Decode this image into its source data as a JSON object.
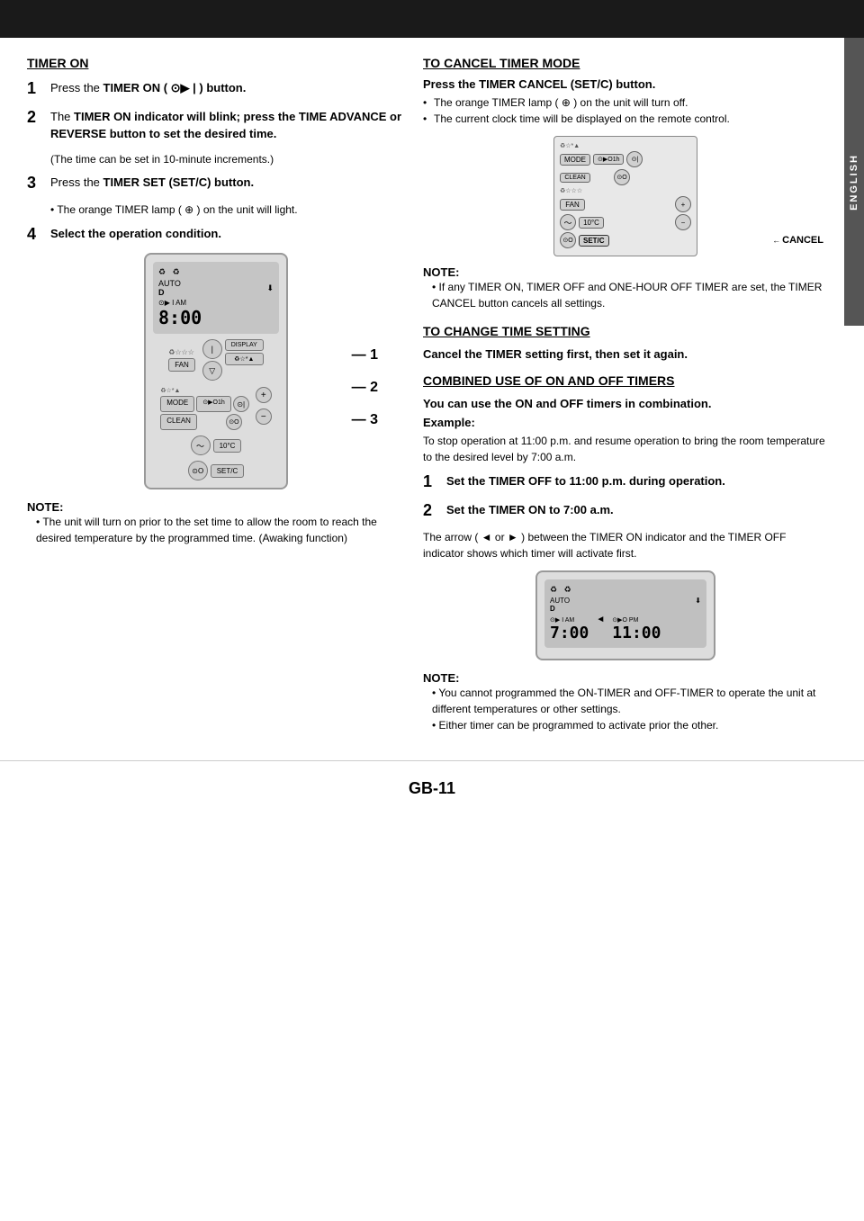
{
  "topBar": {},
  "sidebar": {
    "label": "ENGLISH"
  },
  "leftCol": {
    "timerOn": {
      "title": "TIMER ON",
      "steps": [
        {
          "num": "1",
          "text": "Press the TIMER ON ( ⊙▶ | ) button."
        },
        {
          "num": "2",
          "text": "The TIMER ON indicator will blink; press the TIME ADVANCE or REVERSE button to set the desired time.",
          "sub": "(The time can be set in 10-minute increments.)"
        },
        {
          "num": "3",
          "text": "Press the TIMER SET (SET/C) button.",
          "sub": "• The orange TIMER lamp ( ⊕ ) on the unit will light."
        },
        {
          "num": "4",
          "text": "Select the operation condition."
        }
      ]
    },
    "remote": {
      "icons_top": "♻ ♻",
      "auto_label": "AUTO",
      "auto_d": "D",
      "time_label": "⊙▶ I AM",
      "time_value": "8:00",
      "display_label": "DISPLAY",
      "mode_btn": "MODE",
      "mode_icons": "♻☆*▲",
      "timer1h": "⊙▶O1h",
      "timer_on": "⊙▶ |",
      "clean_btn": "CLEAN",
      "timer_oo": "⊙▶O",
      "fan_btn": "FAN",
      "fan_icons": "♻☆☆☆",
      "plus_btn": "+",
      "wave_btn": "~",
      "temp_btn": "10°C",
      "minus_btn": "−",
      "circle_btn": "⊙O",
      "setc_btn": "SET/C",
      "step_labels": [
        "1",
        "2",
        "3"
      ]
    },
    "note": {
      "title": "NOTE:",
      "text": "The unit will turn on prior to the set time to allow the room to reach the desired temperature by the programmed time. (Awaking function)"
    }
  },
  "rightCol": {
    "cancelSection": {
      "title": "TO CANCEL TIMER MODE",
      "pressLabel": "Press the TIMER CANCEL (SET/C) button.",
      "bullets": [
        "The orange TIMER lamp ( ⊕ ) on the unit will turn off.",
        "The current clock time will be displayed on the remote control."
      ],
      "remote": {
        "mode_icons": "♻☆*▲",
        "mode_btn": "MODE",
        "timer1h": "⊙▶O1h",
        "timer_on": "⊙▶ |",
        "clean_btn": "CLEAN",
        "timer_oo": "⊙▶O",
        "fan_icons": "♻☆☆☆",
        "fan_btn": "FAN",
        "plus_btn": "+",
        "wave_btn": "~",
        "temp_btn": "10°C",
        "minus_btn": "−",
        "circle_btn": "⊙O",
        "setc_btn": "SET/C",
        "cancel_label": "CANCEL"
      },
      "note": {
        "title": "NOTE:",
        "text": "If any TIMER ON, TIMER OFF and ONE-HOUR OFF TIMER are set, the TIMER CANCEL button cancels all settings."
      }
    },
    "changeSection": {
      "title": "TO CHANGE TIME SETTING",
      "text": "Cancel the TIMER setting first, then set it again."
    },
    "combinedSection": {
      "title": "COMBINED USE OF ON AND OFF TIMERS",
      "intro": "You can use the ON and OFF timers in combination.",
      "exampleLabel": "Example:",
      "exampleText": "To stop operation at 11:00 p.m. and resume operation to bring the room temperature to the desired level by 7:00 a.m.",
      "steps": [
        {
          "num": "1",
          "text": "Set the TIMER OFF to 11:00 p.m. during operation."
        },
        {
          "num": "2",
          "text": "Set the TIMER ON to 7:00 a.m."
        }
      ],
      "arrowText": "The arrow ( ◄ or ► ) between the TIMER ON indicator and the TIMER OFF indicator shows which timer will activate first.",
      "remote": {
        "icons_top": "♻ ♻",
        "auto_label": "AUTO",
        "auto_d": "D",
        "time_am": "⊙▶ I AM",
        "time_pm": "⊙▶O PM",
        "time_on": "7:00",
        "time_off": "11:00",
        "arrow": "◄"
      },
      "note": {
        "title": "NOTE:",
        "bullets": [
          "You cannot programmed the ON-TIMER and OFF-TIMER to operate the unit at different temperatures or other settings.",
          "Either timer can be programmed to activate prior the other."
        ]
      }
    }
  },
  "footer": {
    "pageNum": "GB-11"
  }
}
